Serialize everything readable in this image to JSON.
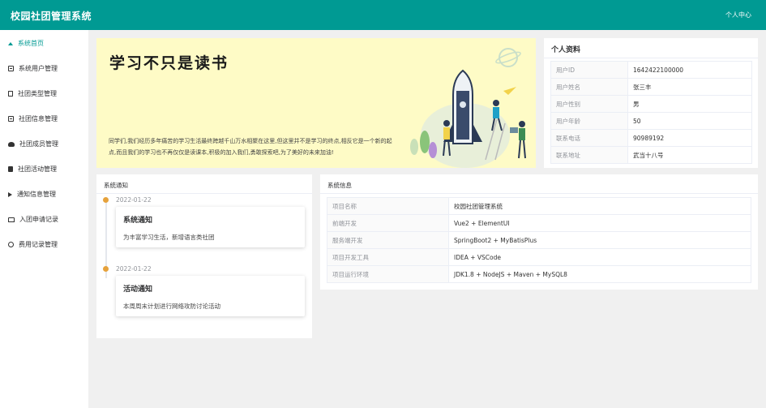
{
  "header": {
    "title": "校园社团管理系统",
    "user_center": "个人中心"
  },
  "sidebar": {
    "items": [
      {
        "label": "系统首页",
        "icon": "home-icon"
      },
      {
        "label": "系统用户管理",
        "icon": "user-card-icon"
      },
      {
        "label": "社团类型管理",
        "icon": "document-icon"
      },
      {
        "label": "社团信息管理",
        "icon": "building-icon"
      },
      {
        "label": "社团成员管理",
        "icon": "users-icon"
      },
      {
        "label": "社团活动管理",
        "icon": "calculator-icon"
      },
      {
        "label": "通知信息管理",
        "icon": "bullhorn-icon"
      },
      {
        "label": "入团申请记录",
        "icon": "inbox-icon"
      },
      {
        "label": "费用记录管理",
        "icon": "clock-icon"
      }
    ],
    "active_index": 0
  },
  "banner": {
    "headline": "学习不只是读书",
    "intro": "同学们,我们经历多年痛苦的学习生活最终跨越千山万水相聚在这里,但这里并不是学习的终点,相反它是一个新的起点,而且我们的学习也不再仅仅是读课本,积极的加入我们,勇敢探索吧,为了美好的未来加油!"
  },
  "profile": {
    "title": "个人资料",
    "rows": [
      {
        "label": "用户ID",
        "value": "1642422100000"
      },
      {
        "label": "用户姓名",
        "value": "张三丰"
      },
      {
        "label": "用户性别",
        "value": "男"
      },
      {
        "label": "用户年龄",
        "value": "50"
      },
      {
        "label": "联系电话",
        "value": "90989192"
      },
      {
        "label": "联系地址",
        "value": "武当十八号"
      }
    ]
  },
  "notices": {
    "title": "系统通知",
    "items": [
      {
        "date": "2022-01-22",
        "title": "系统通知",
        "text": "为丰富学习生活，新增语言类社团"
      },
      {
        "date": "2022-01-22",
        "title": "活动通知",
        "text": "本周周末计划进行网络攻防讨论活动"
      }
    ]
  },
  "sysinfo": {
    "title": "系统信息",
    "rows": [
      {
        "label": "项目名称",
        "value": "校园社团管理系统"
      },
      {
        "label": "前端开发",
        "value": "Vue2 + ElementUI"
      },
      {
        "label": "服务端开发",
        "value": "SpringBoot2 + MyBatisPlus"
      },
      {
        "label": "项目开发工具",
        "value": "IDEA + VSCode"
      },
      {
        "label": "项目运行环境",
        "value": "JDK1.8 + NodeJS + Maven + MySQL8"
      }
    ]
  },
  "colors": {
    "brand": "#009a93",
    "banner_bg": "#fefbc6",
    "timeline_dot": "#e6a23c"
  }
}
